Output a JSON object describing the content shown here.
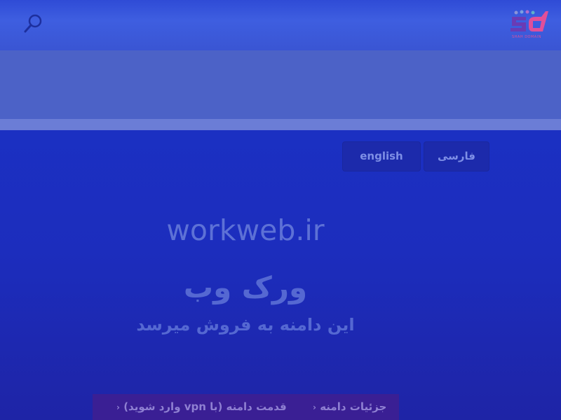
{
  "header": {
    "search_icon": "search-icon",
    "logo_caption": "SHAH DOMAIN"
  },
  "language": {
    "english_label": "english",
    "farsi_label": "فارسی"
  },
  "hero": {
    "domain": "workweb.ir",
    "title_fa": "ورک وب",
    "subtitle_fa": "این دامنه به فروش میرسد"
  },
  "bottom_bar": {
    "details_label": "جزئیات دامنه",
    "history_label": "قدمت دامنه (با vpn وارد شوید)"
  },
  "colors": {
    "background": "#1c2dbd",
    "header": "#3a55d3",
    "button": "#1c2aab",
    "bottom_bar": "#3a1f94",
    "logo_pink": "#e04f9a"
  }
}
